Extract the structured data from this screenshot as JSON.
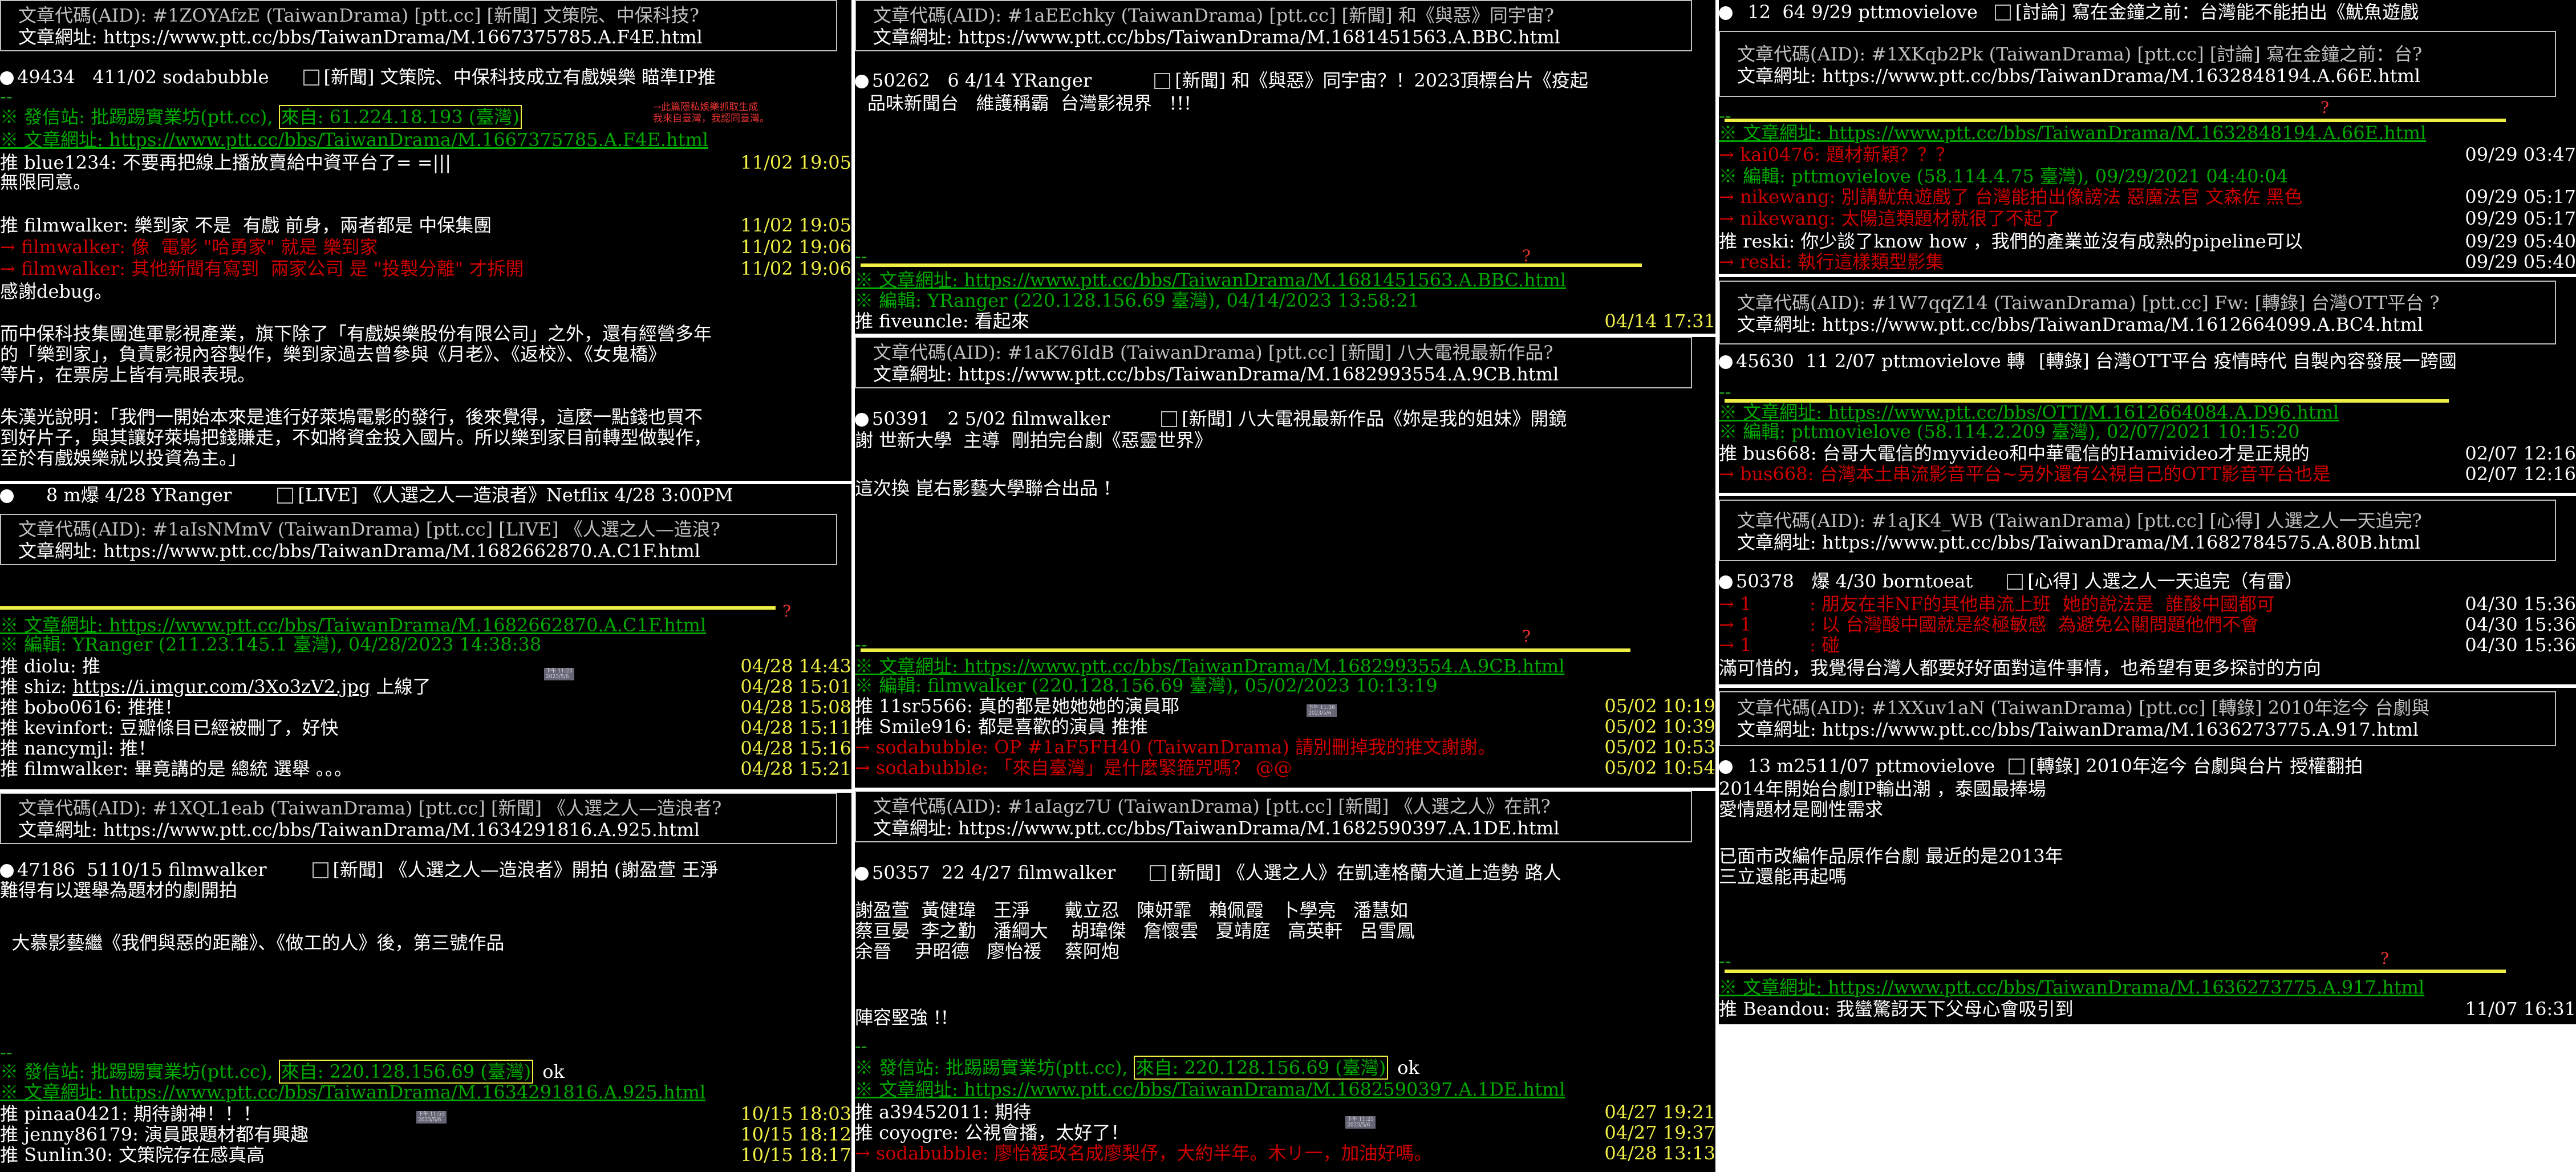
{
  "panels": {
    "l1": {
      "aid": "文章代碼(AID): #1ZOYAfzE (TaiwanDrama) [ptt.cc] [新聞] 文策院、中保科技?",
      "url": "文章網址: https://www.ptt.cc/bbs/TaiwanDrama/M.1667375785.A.F4E.html",
      "list": "49434   411/02 sodabubble",
      "list_title": "[新聞] 文策院、中保科技成立有戲娛樂 瞄準IP推",
      "sep": "--",
      "from_pre": "※ 發信站: 批踢踢實業坊(ptt.cc), ",
      "from_box": "來自: 61.224.18.193 (臺灣)",
      "note": "→此篇隱私娛樂抓取生成\n我來自臺灣，我認同臺灣。",
      "url2": "※ 文章網址: https://www.ptt.cc/bbs/TaiwanDrama/M.1667375785.A.F4E.html",
      "c1": "推 blue1234: 不要再把線上播放賣給中資平台了= =|||",
      "c1t": "11/02 19:05",
      "l_agree": "無限同意。",
      "c2": "推 filmwalker: 樂到家 不是  有戲 前身，兩者都是 中保集團",
      "c2t": "11/02 19:05",
      "c3": "→ filmwalker: 像  電影 \"哈勇家\" 就是 樂到家",
      "c3t": "11/02 19:06",
      "c4": "→ filmwalker: 其他新聞有寫到  兩家公司 是 \"投製分離\" 才拆開",
      "c4t": "11/02 19:06",
      "debug": "感謝debug。",
      "b1": "而中保科技集團進軍影視產業，旗下除了「有戲娛樂股份有限公司」之外，還有經營多年",
      "b2": "的「樂到家」，負責影視內容製作，樂到家過去曾參與《月老》、《返校》、《女鬼橋》",
      "b3": "等片，在票房上皆有亮眼表現。",
      "b4": "朱漢光說明：「我們一開始本來是進行好萊塢電影的發行，後來覺得，這麼一點錢也買不",
      "b5": "到好片子，與其讓好萊塢把錢賺走，不如將資金投入國片。所以樂到家目前轉型做製作，",
      "b6": "至於有戲娛樂就以投資為主。」"
    },
    "l2": {
      "list": "     8 m爆 4/28 YRanger",
      "list_title": "[LIVE] 《人選之人—造浪者》Netflix 4/28 3:00PM",
      "aid": "文章代碼(AID): #1aIsNMmV (TaiwanDrama) [ptt.cc] [LIVE] 《人選之人—造浪?",
      "url": "文章網址: https://www.ptt.cc/bbs/TaiwanDrama/M.1682662870.A.C1F.html",
      "q": "?",
      "url2": "※ 文章網址: https://www.ptt.cc/bbs/TaiwanDrama/M.1682662870.A.C1F.html",
      "edit": "※ 編輯: YRanger (211.23.145.1 臺灣), 04/28/2023 14:38:38",
      "c1": "推 diolu: 推",
      "c1t": "04/28 14:43",
      "c2_pre": "推 shiz: ",
      "c2_link": "https://i.imgur.com/3Xo3zV2.jpg",
      "c2_post": " 上線了",
      "c2t": "04/28 15:01",
      "tag": "下午 11:23\n2023/5/6",
      "c3": "推 bobo0616: 推推！",
      "c3t": "04/28 15:08",
      "c4": "推 kevinfort: 豆瓣條目已經被刪了，好快",
      "c4t": "04/28 15:11",
      "c5": "推 nancymjl: 推！",
      "c5t": "04/28 15:16",
      "c6": "推 filmwalker: 畢竟講的是 總統 選舉 。。。",
      "c6t": "04/28 15:21"
    },
    "l3": {
      "aid": "文章代碼(AID): #1XQL1eab (TaiwanDrama) [ptt.cc] [新聞] 《人選之人—造浪者?",
      "url": "文章網址: https://www.ptt.cc/bbs/TaiwanDrama/M.1634291816.A.925.html",
      "list": "47186  5110/15 filmwalker",
      "list_title": "[新聞] 《人選之人—造浪者》開拍 (謝盈萱 王淨",
      "b0": "難得有以選舉為題材的劇開拍",
      "b1": "  大慕影藝繼《我們與惡的距離》、《做工的人》後，第三號作品",
      "sep": "--",
      "from_pre": "※ 發信站: 批踢踢實業坊(ptt.cc), ",
      "from_box": "來自: 220.128.156.69 (臺灣)",
      "ok": "ok",
      "url2": "※ 文章網址: https://www.ptt.cc/bbs/TaiwanDrama/M.1634291816.A.925.html",
      "c1": "推 pinaa0421: 期待謝神！！！",
      "c1t": "10/15 18:03",
      "tag": "下午 11:53\n2023/5/6",
      "c2": "推 jenny86179: 演員跟題材都有興趣",
      "c2t": "10/15 18:12",
      "c3": "推 Sunlin30: 文策院存在感真高",
      "c3t": "10/15 18:17"
    },
    "m1": {
      "aid": "文章代碼(AID): #1aEEchky (TaiwanDrama) [ptt.cc] [新聞] 和《與惡》同宇宙?",
      "url": "文章網址: https://www.ptt.cc/bbs/TaiwanDrama/M.1681451563.A.BBC.html",
      "list": "50262   6 4/14 YRanger",
      "list_title": "[新聞] 和《與惡》同宇宙？！2023頂標台片《疫起",
      "b0": "品味新聞台   維護稱霸  台灣影視界   !!!",
      "sep": "--",
      "q": "?",
      "url2": "※ 文章網址: https://www.ptt.cc/bbs/TaiwanDrama/M.1681451563.A.BBC.html",
      "edit": "※ 編輯: YRanger (220.128.156.69 臺灣), 04/14/2023 13:58:21",
      "c1": "推 fiveuncle: 看起來",
      "c1t": "04/14 17:31"
    },
    "m2": {
      "aid": "文章代碼(AID): #1aK76IdB (TaiwanDrama) [ptt.cc] [新聞] 八大電視最新作品?",
      "url": "文章網址: https://www.ptt.cc/bbs/TaiwanDrama/M.1682993554.A.9CB.html",
      "list": "50391   2 5/02 filmwalker",
      "list_title": "[新聞] 八大電視最新作品《妳是我的姐妹》開鏡",
      "b0": "謝 世新大學  主導  剛拍完台劇《惡靈世界》",
      "b1": "這次換 崑右影藝大學聯合出品 !",
      "sep": "--",
      "q": "?",
      "url2": "※ 文章網址: https://www.ptt.cc/bbs/TaiwanDrama/M.1682993554.A.9CB.html",
      "edit": "※ 編輯: filmwalker (220.128.156.69 臺灣), 05/02/2023 10:13:19",
      "c1": "推 11sr5566: 真的都是她她她的演員耶",
      "c1t": "05/02 10:19",
      "tag": "下午 11:56\n2023/5/6",
      "c2": "推 Smile916: 都是喜歡的演員 推推",
      "c2t": "05/02 10:39",
      "c3": "→ sodabubble: OP #1aF5FH40 (TaiwanDrama) 請別刪掉我的推文謝謝。",
      "c3t": "05/02 10:53",
      "c4": "→ sodabubble: 「來自臺灣」是什麼緊箍咒嗎？ @@",
      "c4t": "05/02 10:54"
    },
    "m3": {
      "aid": "文章代碼(AID): #1aIagz7U (TaiwanDrama) [ptt.cc] [新聞] 《人選之人》在訊?",
      "url": "文章網址: https://www.ptt.cc/bbs/TaiwanDrama/M.1682590397.A.1DE.html",
      "list": "50357  22 4/27 filmwalker",
      "list_title": "[新聞] 《人選之人》在凱達格蘭大道上造勢 路人",
      "r1": "謝盈萱  黃健瑋   王淨      戴立忍   陳妍霏   賴佩霞   卜學亮   潘慧如",
      "r2": "蔡亘晏  李之勤   潘綱大    胡瑋傑   詹懷雲   夏靖庭   高英軒   呂雪鳳",
      "r3": "余晉    尹昭德   廖怡禐    蔡阿炮",
      "b1": "陣容堅強 !!",
      "sep": "--",
      "from_pre": "※ 發信站: 批踢踢實業坊(ptt.cc), ",
      "from_box": "來自: 220.128.156.69 (臺灣)",
      "ok": "ok",
      "url2": "※ 文章網址: https://www.ptt.cc/bbs/TaiwanDrama/M.1682590397.A.1DE.html",
      "c1": "推 a39452011: 期待",
      "c1t": "04/27 19:21",
      "tag": "下午 11:25\n2023/5/6",
      "c2": "推 coyogre: 公視會播，太好了！",
      "c2t": "04/27 19:37",
      "c3": "→ sodabubble: 廖怡禐改名成廖梨伃，大約半年。木リ一，加油好嗎。",
      "c3t": "04/28 13:13"
    },
    "r1": {
      "list": "  12  64 9/29 pttmovielove",
      "list_title": "[討論] 寫在金鐘之前：台灣能不能拍出《魷魚遊戲",
      "aid": "文章代碼(AID): #1XKqb2Pk (TaiwanDrama) [ptt.cc] [討論] 寫在金鐘之前：台?",
      "url": "文章網址: https://www.ptt.cc/bbs/TaiwanDrama/M.1632848194.A.66E.html",
      "sep": "--",
      "q": "?",
      "url2": "※ 文章網址: https://www.ptt.cc/bbs/TaiwanDrama/M.1632848194.A.66E.html",
      "c1": "→ kai0476: 題材新穎？？？",
      "c1t": "09/29 03:47",
      "edit": "※ 編輯: pttmovielove (58.114.4.75 臺灣), 09/29/2021 04:40:04",
      "c2": "→ nikewang: 別講魷魚遊戲了 台灣能拍出像謗法 惡魔法官 文森佐 黑色",
      "c2t": "09/29 05:17",
      "c3": "→ nikewang: 太陽這類題材就很了不起了",
      "c3t": "09/29 05:17",
      "c4": "推 reski: 你少談了know how ，我們的產業並沒有成熟的pipeline可以",
      "c4t": "09/29 05:40",
      "c5": "→ reski: 執行這樣類型影集",
      "c5t": "09/29 05:40"
    },
    "r2": {
      "aid": "文章代碼(AID): #1W7qqZ14 (TaiwanDrama) [ptt.cc] Fw: [轉錄] 台灣OTT平台 ?",
      "url": "文章網址: https://www.ptt.cc/bbs/TaiwanDrama/M.1612664099.A.BC4.html",
      "list": "45630  11 2/07 pttmovielove 轉",
      "list_title": "[轉錄] 台灣OTT平台 疫情時代 自製內容發展一跨國",
      "sep": "--",
      "url2": "※ 文章網址: https://www.ptt.cc/bbs/OTT/M.1612664084.A.D96.html",
      "edit": "※ 編輯: pttmovielove (58.114.2.209 臺灣), 02/07/2021 10:15:20",
      "c1": "推 bus668: 台哥大電信的myvideo和中華電信的Hamivideo才是正規的",
      "c1t": "02/07 12:16",
      "c2": "→ bus668: 台灣本土串流影音平台~另外還有公視自己的OTT影音平台也是",
      "c2t": "02/07 12:16"
    },
    "r3": {
      "aid": "文章代碼(AID): #1aJK4_WB (TaiwanDrama) [ptt.cc] [心得] 人選之人一天追完?",
      "url": "文章網址: https://www.ptt.cc/bbs/TaiwanDrama/M.1682784575.A.80B.html",
      "list": "50378   爆 4/30 borntoeat",
      "list_title": "[心得] 人選之人一天追完（有雷）",
      "c1": "→ 1          : 朋友在非NF的其他串流上班  她的說法是  誰酸中國都可",
      "c1t": "04/30 15:36",
      "c2": "→ 1          : 以 台灣酸中國就是終極敏感  為避免公關問題他們不會",
      "c2t": "04/30 15:36",
      "c3": "→ 1          : 碰",
      "c3t": "04/30 15:36",
      "b1": "滿可惜的，我覺得台灣人都要好好面對這件事情，也希望有更多探討的方向"
    },
    "r4": {
      "aid": "文章代碼(AID): #1XXuv1aN (TaiwanDrama) [ptt.cc] [轉錄] 2010年迄今 台劇與",
      "url": "文章網址: https://www.ptt.cc/bbs/TaiwanDrama/M.1636273775.A.917.html",
      "list": "  13 m2511/07 pttmovielove",
      "list_title": "[轉錄] 2010年迄今 台劇與台片 授權翻拍",
      "b1": "2014年開始台劇IP輸出潮 ，泰國最捧場",
      "b2": "愛情題材是剛性需求",
      "b3": "已面市改編作品原作台劇 最近的是2013年",
      "b4": "三立還能再起嗎",
      "sep": "--",
      "q": "?",
      "url2": "※ 文章網址: https://www.ptt.cc/bbs/TaiwanDrama/M.1636273775.A.917.html",
      "c1": "推 Beandou: 我蠻驚訝天下父母心會吸引到",
      "c1t": "11/07 16:31"
    }
  }
}
